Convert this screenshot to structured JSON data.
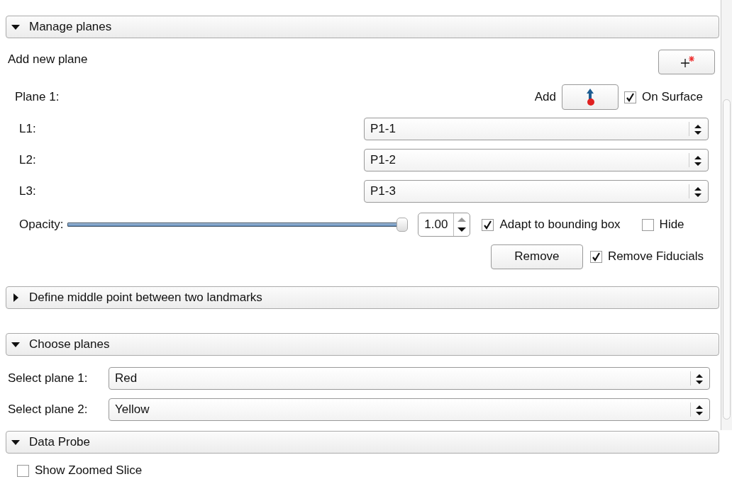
{
  "manage_planes": {
    "title": "Manage planes",
    "expanded": true,
    "add_new_plane_label": "Add new plane",
    "plane": {
      "label": "Plane 1:",
      "add_label": "Add",
      "on_surface": {
        "label": "On Surface",
        "checked": true
      }
    },
    "landmarks": [
      {
        "label": "L1:",
        "value": "P1-1"
      },
      {
        "label": "L2:",
        "value": "P1-2"
      },
      {
        "label": "L3:",
        "value": "P1-3"
      }
    ],
    "opacity": {
      "label": "Opacity:",
      "level": 1,
      "value": "1.00"
    },
    "adapt": {
      "label": "Adapt to bounding box",
      "checked": true
    },
    "hide": {
      "label": "Hide",
      "checked": false
    },
    "remove_button": "Remove",
    "remove_fiducials": {
      "label": "Remove Fiducials",
      "checked": true
    }
  },
  "define_middle": {
    "title": "Define middle point between two landmarks",
    "expanded": false
  },
  "choose_planes": {
    "title": "Choose planes",
    "expanded": true,
    "selects": [
      {
        "label": "Select plane 1:",
        "value": "Red"
      },
      {
        "label": "Select plane 2:",
        "value": "Yellow"
      }
    ]
  },
  "data_probe": {
    "title": "Data Probe",
    "expanded": true,
    "show_zoomed_slice": {
      "label": "Show Zoomed Slice",
      "checked": false
    }
  }
}
